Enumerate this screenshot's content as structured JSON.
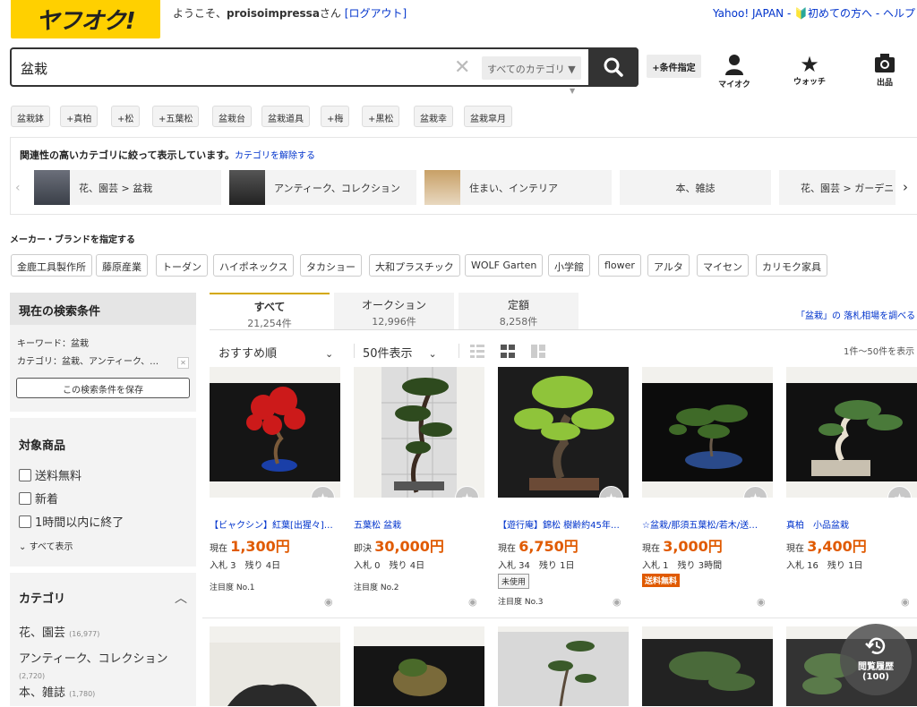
{
  "header": {
    "logo": "ヤフオク!",
    "welcome_prefix": "ようこそ、",
    "username": "proisoimpressa",
    "welcome_suffix": "さん",
    "logout": "[ログアウト]",
    "links": "Yahoo! JAPAN - 🔰初めての方へ - ヘルプ"
  },
  "search": {
    "query": "盆栽",
    "category": "すべてのカテゴリ",
    "conditions": "+条件指定"
  },
  "nav": {
    "my": "マイオク",
    "watch": "ウォッチ",
    "sell": "出品"
  },
  "chips": [
    "盆栽鉢",
    "+真柏",
    "+松",
    "+五葉松",
    "盆栽台",
    "盆栽道具",
    "+梅",
    "+黒松",
    "盆栽幸",
    "盆栽皐月"
  ],
  "related": {
    "text": "関連性の高いカテゴリに絞って表示しています。",
    "link": "カテゴリを解除する",
    "items": [
      "花、園芸 > 盆栽",
      "アンティーク、コレクション",
      "住まい、インテリア",
      "本、雑誌",
      "花、園芸 > ガーデニ"
    ]
  },
  "maker": {
    "title": "メーカー・ブランドを指定する",
    "items": [
      "金鹿工具製作所",
      "藤原産業",
      "トーダン",
      "ハイポネックス",
      "タカショー",
      "大和プラスチック",
      "WOLF Garten",
      "小学館",
      "flower",
      "アルタ",
      "マイセン",
      "カリモク家具"
    ]
  },
  "sidebar": {
    "current_title": "現在の検索条件",
    "keyword": "キーワード：盆栽",
    "category": "カテゴリ：盆栽、アンティーク、…",
    "save": "この検索条件を保存",
    "target_title": "対象商品",
    "checks": [
      "送料無料",
      "新着",
      "1時間以内に終了"
    ],
    "show_all": "すべて表示",
    "cat_title": "カテゴリ",
    "cats": [
      {
        "name": "花、園芸",
        "count": "(16,977)"
      },
      {
        "name": "アンティーク、コレクション",
        "count": "(2,720)"
      },
      {
        "name": "本、雑誌",
        "count": "(1,780)"
      }
    ]
  },
  "tabs": [
    {
      "label": "すべて",
      "count": "21,254件"
    },
    {
      "label": "オークション",
      "count": "12,996件"
    },
    {
      "label": "定額",
      "count": "8,258件"
    }
  ],
  "market_link": "「盆栽」の 落札相場を調べる",
  "sort": {
    "order": "おすすめ順",
    "per_page": "50件表示",
    "range": "1件〜50件を表示"
  },
  "items": [
    {
      "title": "【ビャクシン】紅葉[出猩々]…",
      "price_label": "現在",
      "price": "1,300円",
      "bids": "入札  3",
      "remain": "残り  4日",
      "attention": "注目度 No.1"
    },
    {
      "title": "五葉松 盆栽",
      "price_label": "即決",
      "price": "30,000円",
      "bids": "入札  0",
      "remain": "残り  4日",
      "attention": "注目度 No.2"
    },
    {
      "title": "【遊行庵】錦松 樹齢約45年…",
      "price_label": "現在",
      "price": "6,750円",
      "bids": "入札  34",
      "remain": "残り  1日",
      "badge": "未使用",
      "attention": "注目度 No.3"
    },
    {
      "title": "☆盆栽/那須五葉松/若木/送…",
      "price_label": "現在",
      "price": "3,000円",
      "bids": "入札  1",
      "remain": "残り  3時間",
      "badge": "送料無料"
    },
    {
      "title": "真柏　小品盆栽",
      "price_label": "現在",
      "price": "3,400円",
      "bids": "入札  16",
      "remain": "残り  1日"
    }
  ],
  "history": {
    "label": "閲覧履歴",
    "count": "(100)"
  }
}
